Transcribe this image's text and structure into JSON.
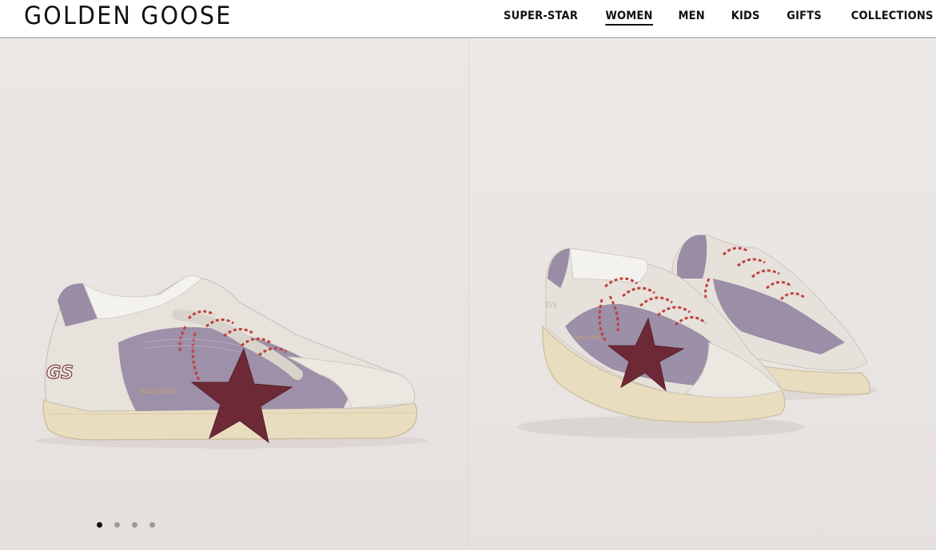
{
  "brand": {
    "logo_text": "GOLDEN GOOSE"
  },
  "nav": {
    "items": [
      {
        "label": "SUPER-STAR",
        "active": false
      },
      {
        "label": "WOMEN",
        "active": true
      },
      {
        "label": "MEN",
        "active": false
      },
      {
        "label": "KIDS",
        "active": false
      },
      {
        "label": "GIFTS",
        "active": false
      },
      {
        "label": "COLLECTIONS",
        "active": false
      }
    ]
  },
  "gallery": {
    "images": [
      {
        "icon": "sneaker-side-view-image"
      },
      {
        "icon": "sneaker-pair-image"
      }
    ],
    "carousel": {
      "total": 4,
      "active_index": 0
    },
    "colors": {
      "background": "#e9e5e3",
      "suede": "#9c8fa6",
      "leather_upper": "#e6e3dc",
      "star": "#6e2a34",
      "sole": "#e8dcbe"
    }
  }
}
